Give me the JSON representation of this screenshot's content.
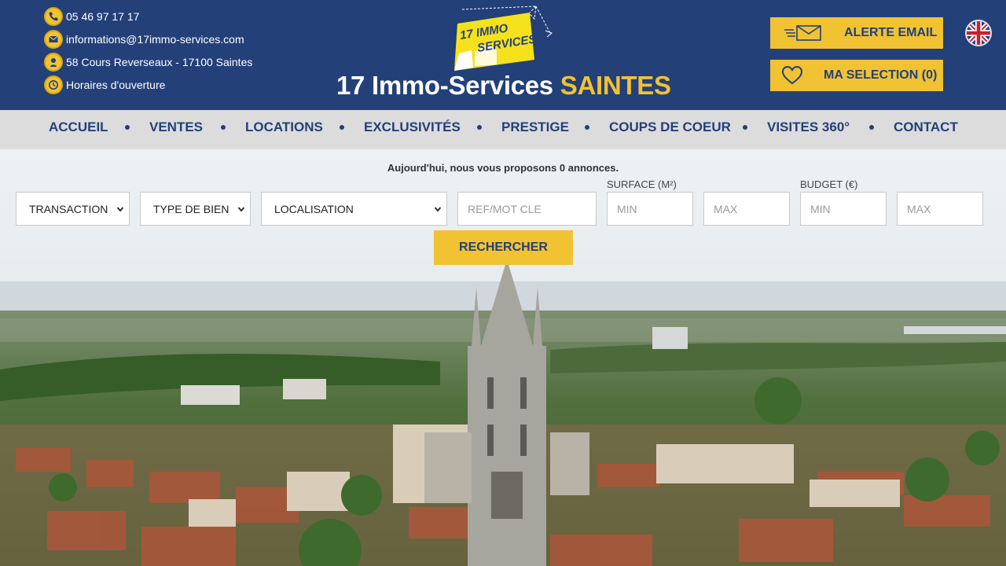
{
  "contact": {
    "phone": "05 46 97 17 17",
    "email": "informations@17immo-services.com",
    "address": "58 Cours Reverseaux - 17100 Saintes",
    "hours_link": "Horaires d'ouverture"
  },
  "brand": {
    "logo_line1": "17 IMMO",
    "logo_line2": "SERVICES",
    "title_main": "17 Immo-Services",
    "title_accent": "SAINTES"
  },
  "header_buttons": {
    "alert_email": "ALERTE EMAIL",
    "my_selection": "MA SELECTION (0)"
  },
  "language_flag": "uk-flag-icon",
  "nav": {
    "items": [
      "ACCUEIL",
      "VENTES",
      "LOCATIONS",
      "EXCLUSIVITÉS",
      "PRESTIGE",
      "COUPS DE COEUR",
      "VISITES 360°",
      "CONTACT"
    ]
  },
  "search": {
    "intro": "Aujourd'hui, nous vous proposons 0 annonces.",
    "transaction": "TRANSACTION",
    "property_type": "TYPE DE BIEN",
    "location": "LOCALISATION",
    "ref_placeholder": "REF/MOT CLE",
    "surface_label": "SURFACE (M²)",
    "budget_label": "BUDGET (€)",
    "min_placeholder": "MIN",
    "max_placeholder": "MAX",
    "submit": "RECHERCHER"
  },
  "colors": {
    "navy": "#234079",
    "yellow": "#f1c232",
    "nav_bg": "#dcdcdc"
  }
}
